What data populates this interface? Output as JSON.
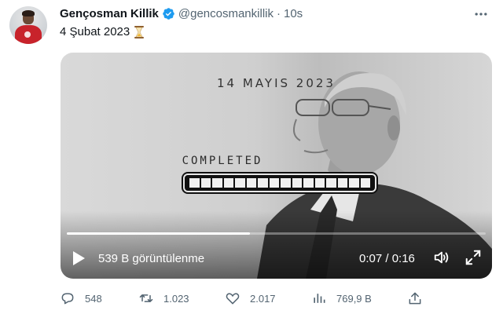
{
  "author": {
    "name": "Gençosman Killik",
    "handle": "@gencosmankillik",
    "separator": "·",
    "time": "10s"
  },
  "tweet": {
    "text": "4 Şubat 2023",
    "emoji_icon": "hourglass-icon"
  },
  "video": {
    "overlay_date": "14 MAYIS 2023",
    "overlay_status": "COMPLETED",
    "loading_segments": 16,
    "views": "539 B görüntülenme",
    "timecode": "0:07 / 0:16",
    "progress": 0.4375
  },
  "actions": {
    "replies": "548",
    "retweets": "1.023",
    "likes": "2.017",
    "views": "769,9 B"
  },
  "colors": {
    "verified": "#1d9bf0",
    "muted_text": "#536471",
    "primary_text": "#0f1419"
  }
}
